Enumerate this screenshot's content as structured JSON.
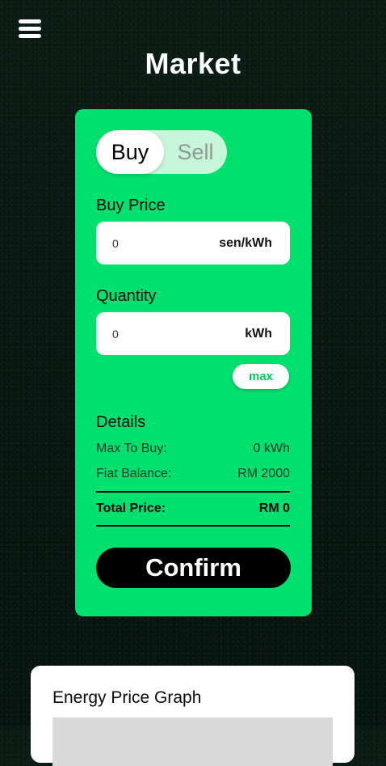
{
  "header": {
    "title": "Market"
  },
  "trade_form": {
    "toggle": {
      "buy_label": "Buy",
      "sell_label": "Sell",
      "selected": "Buy"
    },
    "buy_price": {
      "label": "Buy Price",
      "value": "0",
      "unit": "sen/kWh"
    },
    "quantity": {
      "label": "Quantity",
      "value": "0",
      "unit": "kWh"
    },
    "max_label": "max",
    "details": {
      "title": "Details",
      "max_to_buy_label": "Max To Buy:",
      "max_to_buy_value": "0 kWh",
      "fiat_balance_label": "Fiat Balance:",
      "fiat_balance_value": "RM 2000",
      "total_price_label": "Total Price:",
      "total_price_value": "RM 0"
    },
    "confirm_label": "Confirm"
  },
  "graph": {
    "title": "Energy Price Graph"
  },
  "colors": {
    "accent": "#00e06e",
    "background": "#071510",
    "button": "#000000"
  }
}
